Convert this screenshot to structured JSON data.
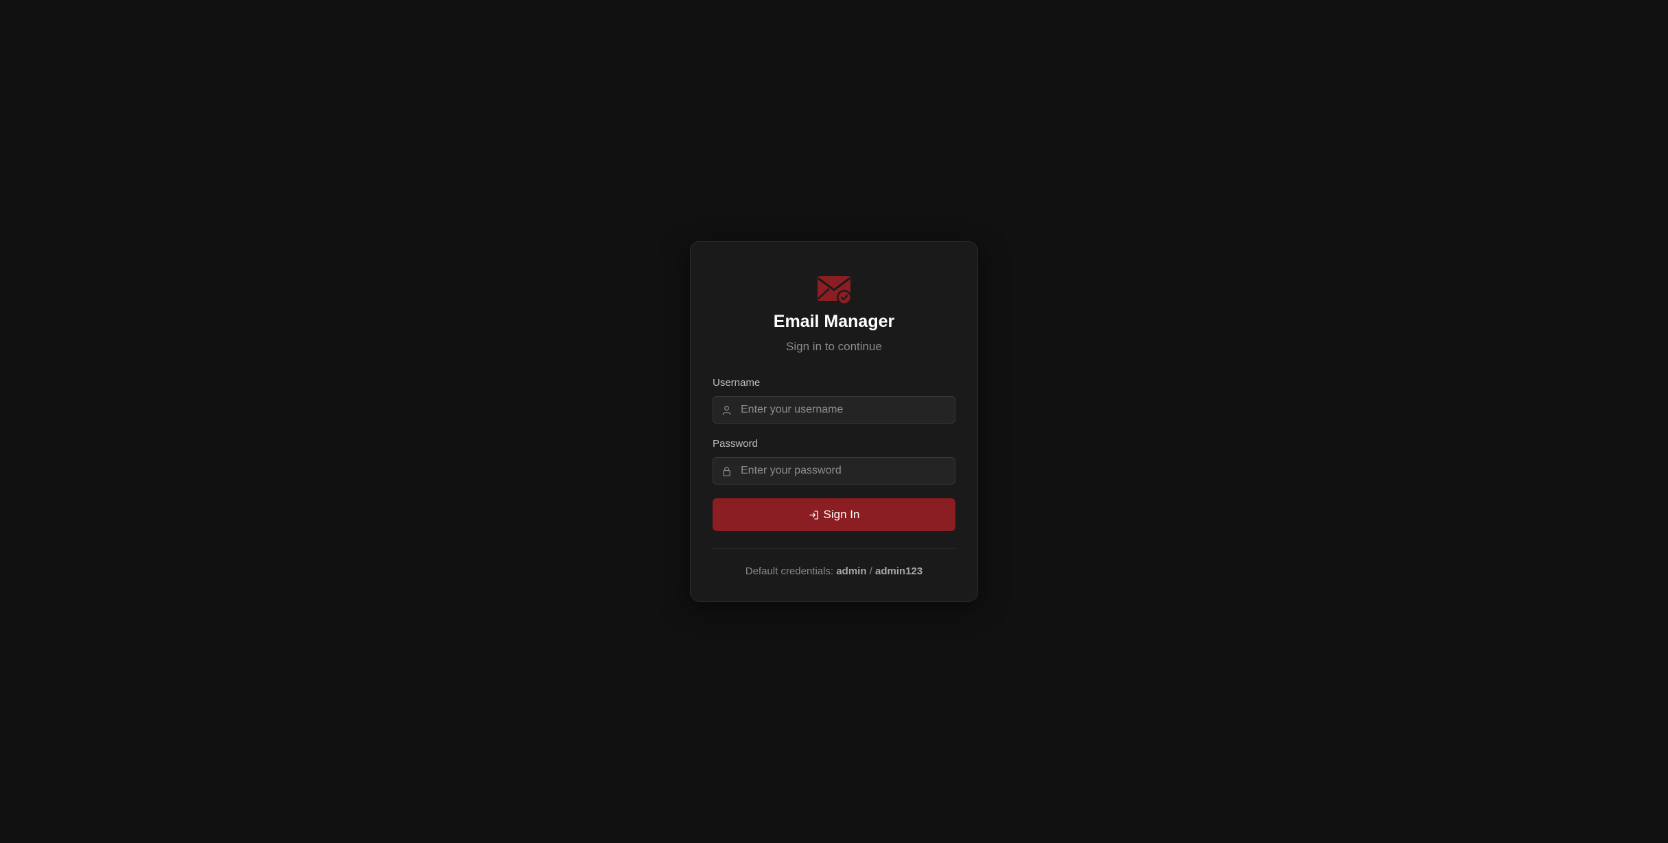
{
  "app": {
    "title": "Email Manager",
    "subtitle": "Sign in to continue",
    "logo_icon": "mail-check-icon",
    "accent_color": "#8b1e22"
  },
  "form": {
    "username": {
      "label": "Username",
      "placeholder": "Enter your username",
      "value": "",
      "icon": "user-icon"
    },
    "password": {
      "label": "Password",
      "placeholder": "Enter your password",
      "value": "",
      "icon": "lock-icon"
    },
    "submit": {
      "label": "Sign In",
      "icon": "log-in-icon"
    }
  },
  "footer": {
    "prefix": "Default credentials:",
    "username": "admin",
    "separator": "/",
    "password": "admin123"
  }
}
